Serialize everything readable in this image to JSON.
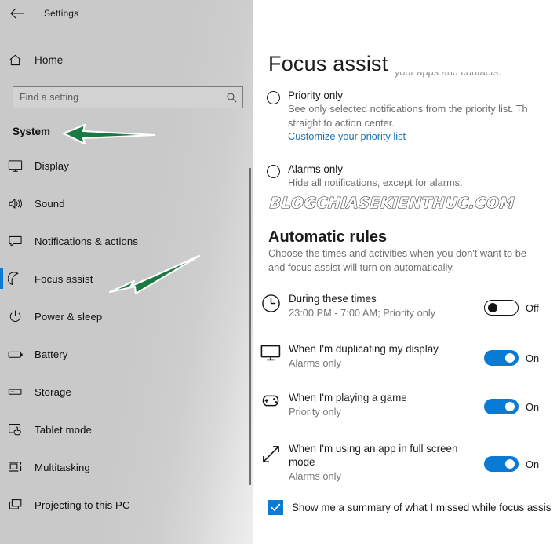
{
  "colors": {
    "accent": "#0a7bd4",
    "link": "#1673b8",
    "arrow_fill": "#1b7a43",
    "arrow_outline": "#ffffff",
    "text_primary": "#1b1b1b",
    "text_secondary": "#6e6e6e"
  },
  "window": {
    "back_label": "back-arrow",
    "app_title": "Settings"
  },
  "sidebar": {
    "home_label": "Home",
    "search": {
      "placeholder": "Find a setting",
      "value": "",
      "icon": "search-icon"
    },
    "section_header": "System",
    "items": [
      {
        "label": "Display",
        "icon": "monitor-icon",
        "selected": false
      },
      {
        "label": "Sound",
        "icon": "speaker-icon",
        "selected": false
      },
      {
        "label": "Notifications & actions",
        "icon": "chat-bubble-icon",
        "selected": false
      },
      {
        "label": "Focus assist",
        "icon": "moon-icon",
        "selected": true
      },
      {
        "label": "Power & sleep",
        "icon": "power-icon",
        "selected": false
      },
      {
        "label": "Battery",
        "icon": "battery-icon",
        "selected": false
      },
      {
        "label": "Storage",
        "icon": "drive-icon",
        "selected": false
      },
      {
        "label": "Tablet mode",
        "icon": "tablet-touch-icon",
        "selected": false
      },
      {
        "label": "Multitasking",
        "icon": "multitask-icon",
        "selected": false
      },
      {
        "label": "Projecting to this PC",
        "icon": "project-icon",
        "selected": false
      }
    ]
  },
  "main": {
    "page_title": "Focus assist",
    "clipped_line": "Get all notifications from your apps and contacts.",
    "watermark": "BLOGCHIASEKIENTHUC.COM",
    "radio_options": [
      {
        "title": "Priority only",
        "desc_line1": "See only selected notifications from the priority list. Th",
        "desc_line2": "straight to action center.",
        "link": "Customize your priority list",
        "selected": false
      },
      {
        "title": "Alarms only",
        "desc_line1": "Hide all notifications, except for alarms.",
        "desc_line2": "",
        "link": "",
        "selected": false
      }
    ],
    "rules_heading": "Automatic rules",
    "rules_desc_line1": "Choose the times and activities when you don't want to be",
    "rules_desc_line2": "and focus assist will turn on automatically.",
    "rules": [
      {
        "title": "During these times",
        "sub": "23:00 PM - 7:00 AM; Priority only",
        "icon": "clock-icon",
        "state": "off",
        "state_label": "Off"
      },
      {
        "title": "When I'm duplicating my display",
        "sub": "Alarms only",
        "icon": "monitor-icon",
        "state": "on",
        "state_label": "On"
      },
      {
        "title": "When I'm playing a game",
        "sub": "Priority only",
        "icon": "gamepad-icon",
        "state": "on",
        "state_label": "On"
      },
      {
        "title": "When I'm using an app in full screen",
        "title_line2": "mode",
        "sub": "Alarms only",
        "icon": "fullscreen-arrows-icon",
        "state": "on",
        "state_label": "On"
      }
    ],
    "summary_checkbox": {
      "label": "Show me a summary of what I missed while focus assis",
      "checked": true
    }
  },
  "annotations": [
    {
      "name": "arrow-pointing-to-system",
      "target": "System"
    },
    {
      "name": "arrow-pointing-to-focus-assist",
      "target": "Focus assist"
    }
  ]
}
